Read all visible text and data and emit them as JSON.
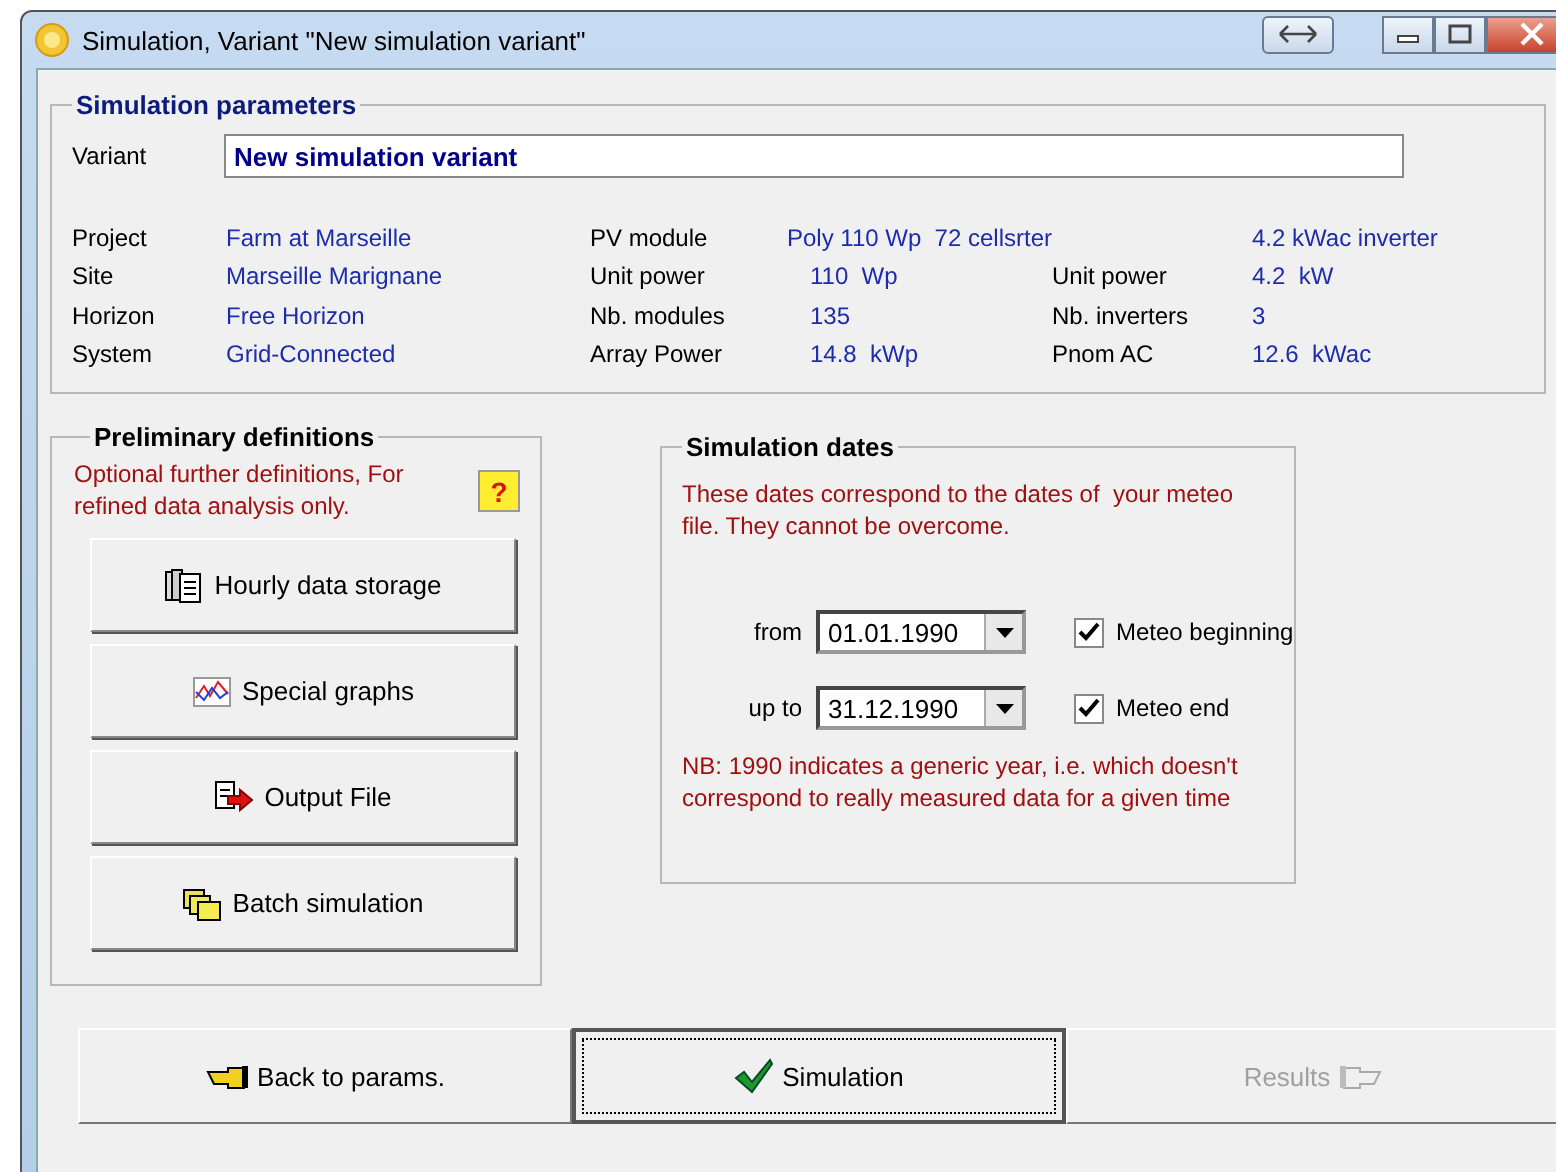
{
  "window": {
    "title": "Simulation, Variant  \"New simulation variant\""
  },
  "parameters": {
    "title": "Simulation parameters",
    "variant_label": "Variant",
    "variant_value": "New simulation variant",
    "columns": [
      {
        "items": [
          {
            "label": "Project",
            "value": "Farm at Marseille"
          },
          {
            "label": "Site",
            "value": "Marseille Marignane"
          },
          {
            "label": "Horizon",
            "value": "Free Horizon"
          },
          {
            "label": "System",
            "value": "Grid-Connected"
          }
        ]
      },
      {
        "items": [
          {
            "label": "PV module",
            "value": "Poly 110 Wp  72 cellsrter"
          },
          {
            "label": "Unit power",
            "value": "110  Wp"
          },
          {
            "label": "Nb. modules",
            "value": "135"
          },
          {
            "label": "Array Power",
            "value": "14.8  kWp"
          }
        ]
      },
      {
        "items": [
          {
            "value": "4.2 kWac inverter"
          },
          {
            "label": "Unit power",
            "value": "4.2  kW"
          },
          {
            "label": "Nb. inverters",
            "value": "3"
          },
          {
            "label": "Pnom AC",
            "value": "12.6  kWac"
          }
        ]
      }
    ]
  },
  "preliminary": {
    "title": "Preliminary definitions",
    "note": "Optional further definitions, For refined data analysis only.",
    "help": "?",
    "buttons": [
      {
        "label": "Hourly data storage",
        "kind": "storage"
      },
      {
        "label": "Special graphs",
        "kind": "graph"
      },
      {
        "label": "Output File",
        "kind": "output"
      },
      {
        "label": "Batch simulation",
        "kind": "batch"
      }
    ]
  },
  "dates": {
    "title": "Simulation dates",
    "note": "These dates correspond to the dates of  your meteo file. They cannot be overcome.",
    "rows": [
      {
        "label": "from",
        "value": "01.01.1990",
        "check_label": "Meteo beginning",
        "checked": true
      },
      {
        "label": "up to",
        "value": "31.12.1990",
        "check_label": "Meteo end",
        "checked": true
      }
    ],
    "footnote": "NB: 1990 indicates a generic year, i.e. which doesn't correspond to really measured data for a given time"
  },
  "bottom_buttons": [
    {
      "label": "Back to params.",
      "kind": "back",
      "disabled": false,
      "focused": false
    },
    {
      "label": "Simulation",
      "kind": "check",
      "disabled": false,
      "focused": true
    },
    {
      "label": "Results",
      "kind": "forward",
      "disabled": true,
      "focused": false
    }
  ]
}
